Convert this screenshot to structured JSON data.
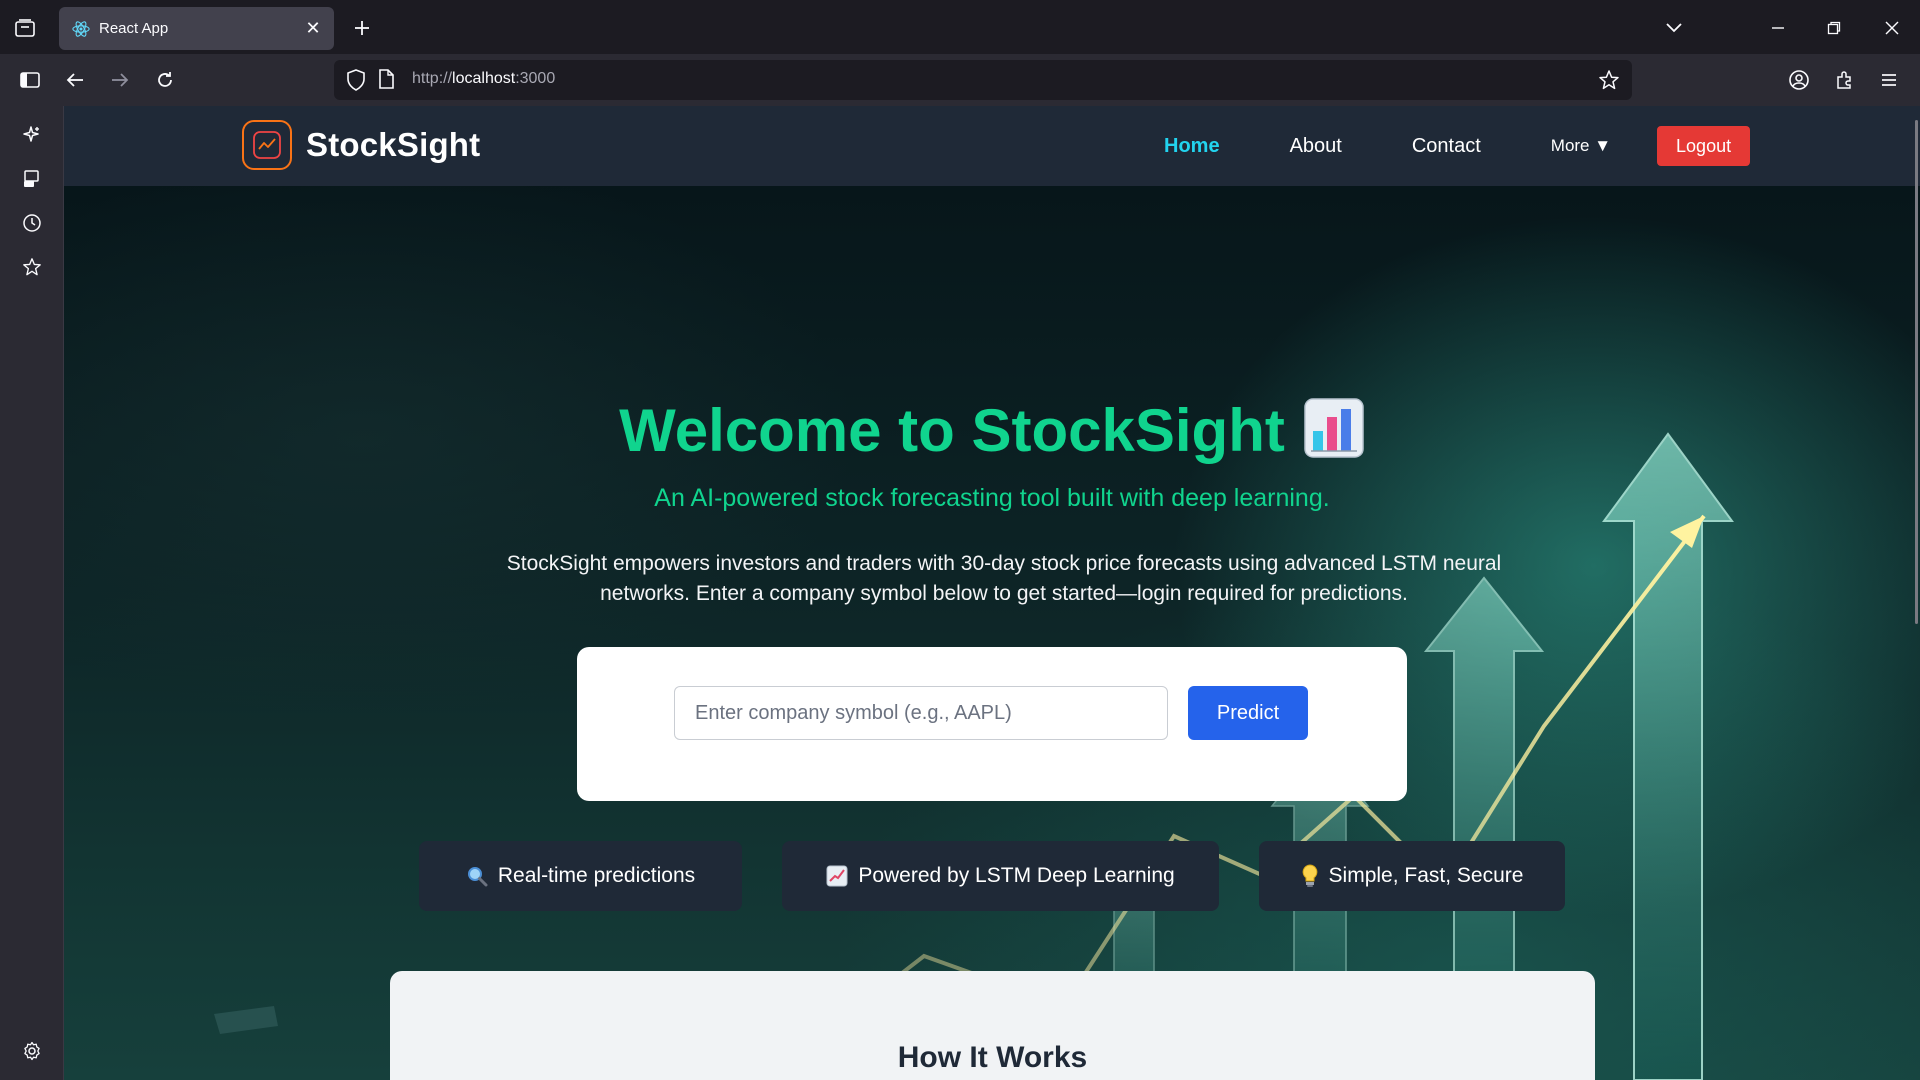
{
  "browser": {
    "tab_title": "React App",
    "url_scheme": "http://",
    "url_host": "localhost",
    "url_rest": ":3000"
  },
  "site": {
    "brand": "StockSight",
    "nav": {
      "home": "Home",
      "about": "About",
      "contact": "Contact",
      "more": "More ▼",
      "logout": "Logout"
    },
    "accent_color": "#10d48e",
    "active_link_color": "#22d3ee",
    "logout_color": "#e53935",
    "predict_color": "#2563eb"
  },
  "hero": {
    "title": "Welcome to StockSight",
    "title_icon": "bar-chart-emoji",
    "subtitle": "An AI-powered stock forecasting tool built with deep learning.",
    "description": "StockSight empowers investors and traders with 30-day stock price forecasts using advanced LSTM neural networks. Enter a company symbol below to get started—login required for predictions."
  },
  "search": {
    "placeholder": "Enter company symbol (e.g., AAPL)",
    "value": "",
    "button": "Predict"
  },
  "features": [
    {
      "icon": "magnifier-emoji",
      "label": "Real-time predictions"
    },
    {
      "icon": "chart-up-emoji",
      "label": "Powered by LSTM Deep Learning"
    },
    {
      "icon": "lightbulb-emoji",
      "label": "Simple, Fast, Secure"
    }
  ],
  "how_it_works": {
    "title": "How It Works"
  }
}
